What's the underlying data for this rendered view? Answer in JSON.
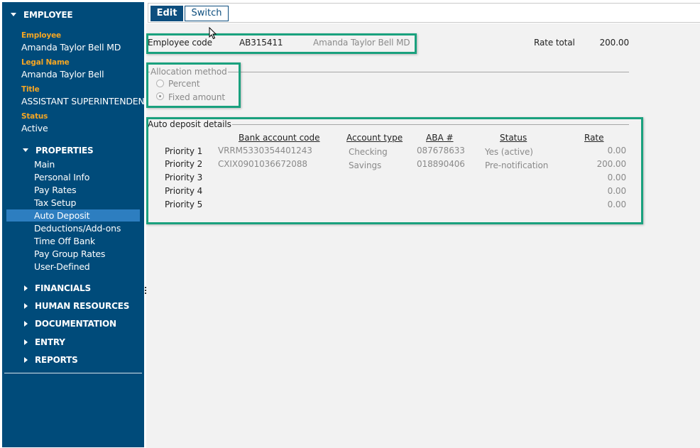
{
  "sidebar": {
    "employee_header": "EMPLOYEE",
    "info": [
      {
        "label": "Employee",
        "value": "Amanda Taylor Bell MD"
      },
      {
        "label": "Legal Name",
        "value": "Amanda Taylor Bell"
      },
      {
        "label": "Title",
        "value": "ASSISTANT SUPERINTENDENT"
      },
      {
        "label": "Status",
        "value": "Active"
      }
    ],
    "properties_header": "PROPERTIES",
    "items": [
      {
        "label": "Main"
      },
      {
        "label": "Personal Info"
      },
      {
        "label": "Pay Rates"
      },
      {
        "label": "Tax Setup"
      },
      {
        "label": "Auto Deposit",
        "active": true
      },
      {
        "label": "Deductions/Add-ons"
      },
      {
        "label": "Time Off Bank"
      },
      {
        "label": "Pay Group Rates"
      },
      {
        "label": "User-Defined"
      }
    ],
    "sections": [
      {
        "label": "FINANCIALS"
      },
      {
        "label": "HUMAN RESOURCES"
      },
      {
        "label": "DOCUMENTATION"
      },
      {
        "label": "ENTRY"
      },
      {
        "label": "REPORTS"
      }
    ],
    "colors": {
      "background": "#004b7a",
      "accent_label": "#f5a623",
      "active_item": "#2d7ec0"
    }
  },
  "toolbar": {
    "edit_label": "Edit",
    "switch_label": "Switch"
  },
  "employee": {
    "code_label": "Employee code",
    "code": "AB315411",
    "name": "Amanda Taylor Bell MD",
    "rate_total_label": "Rate total",
    "rate_total": "200.00"
  },
  "allocation": {
    "title": "Allocation method",
    "options": [
      {
        "label": "Percent",
        "selected": false
      },
      {
        "label": "Fixed amount",
        "selected": true
      }
    ]
  },
  "auto_deposit": {
    "title": "Auto deposit details",
    "columns": [
      "Bank account code",
      "Account type",
      "ABA #",
      "Status",
      "Rate"
    ],
    "rows": [
      {
        "priority": "Priority 1",
        "account": "VRRM5330354401243",
        "type": "Checking",
        "aba": "087678633",
        "status": "Yes (active)",
        "rate": "0.00"
      },
      {
        "priority": "Priority 2",
        "account": "CXIX0901036672088",
        "type": "Savings",
        "aba": "018890406",
        "status": "Pre-notification",
        "rate": "200.00"
      },
      {
        "priority": "Priority 3",
        "account": "",
        "type": "",
        "aba": "",
        "status": "",
        "rate": "0.00"
      },
      {
        "priority": "Priority 4",
        "account": "",
        "type": "",
        "aba": "",
        "status": "",
        "rate": "0.00"
      },
      {
        "priority": "Priority 5",
        "account": "",
        "type": "",
        "aba": "",
        "status": "",
        "rate": "0.00"
      }
    ]
  },
  "highlight_color": "#1aa17e"
}
